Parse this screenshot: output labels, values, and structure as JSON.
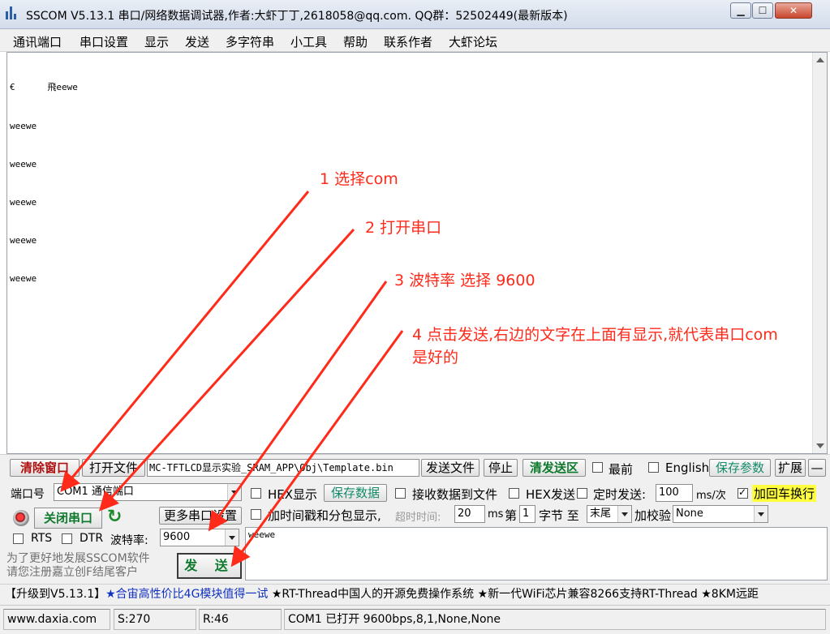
{
  "window": {
    "title": "SSCOM V5.13.1 串口/网络数据调试器,作者:大虾丁丁,2618058@qq.com. QQ群：52502449(最新版本)",
    "min": "▁",
    "max": "☐",
    "close": "✕"
  },
  "menu": [
    "通讯端口",
    "串口设置",
    "显示",
    "发送",
    "多字符串",
    "小工具",
    "帮助",
    "联系作者",
    "大虾论坛"
  ],
  "receive": {
    "lines": [
      "€      飛eewe",
      "weewe",
      "weewe",
      "weewe",
      "weewe",
      "weewe"
    ]
  },
  "toolbar": {
    "clear_window": "清除窗口",
    "open_file": "打开文件",
    "file_path": "MC-TFTLCD显示实验_SRAM_APP\\Obj\\Template.bin",
    "send_file": "发送文件",
    "stop": "停止",
    "clear_send": "清发送区",
    "top_most": "最前",
    "english": "English",
    "save_params": "保存参数",
    "expand": "扩展",
    "collapse": "—"
  },
  "port": {
    "label": "端口号",
    "value": "COM1 通信端口",
    "close_button": "关闭串口",
    "more_settings": "更多串口设置",
    "rts": "RTS",
    "dtr": "DTR",
    "baud_label": "波特率:",
    "baud_value": "9600"
  },
  "options": {
    "hex_display": "HEX显示",
    "save_data": "保存数据",
    "recv_to_file": "接收数据到文件",
    "hex_send": "HEX发送",
    "timed_send": "定时发送:",
    "interval_value": "100",
    "interval_unit": "ms/次",
    "add_crlf": "加回车换行",
    "timestamp": "加时间戳和分包显示,",
    "timeout_label": "超时时间:",
    "timeout_value": "20",
    "timeout_unit": "ms",
    "byte_prefix": "第",
    "byte_value": "1",
    "byte_suffix": "字节 至",
    "end_value": "末尾",
    "checksum_label": "加校验",
    "checksum_value": "None"
  },
  "send": {
    "text": "weewe",
    "button": "发  送",
    "notice": "为了更好地发展SSCOM软件\n请您注册嘉立创F结尾客户"
  },
  "ticker": {
    "items": [
      {
        "text": "【升级到V5.13.1】",
        "color": "black"
      },
      {
        "text": "★合宙高性价比4G模块值得一试",
        "color": "blue"
      },
      {
        "text": " ★RT-Thread中国人的开源免费操作系统 ★新一代WiFi芯片兼容8266支持RT-Thread ★8KM远距",
        "color": "black"
      }
    ]
  },
  "status": {
    "site": "www.daxia.com",
    "sent": "S:270",
    "received": "R:46",
    "port_state": "COM1 已打开  9600bps,8,1,None,None"
  },
  "annotations": {
    "step1": "1 选择com",
    "step2": "2 打开串口",
    "step3": "3 波特率 选择 9600",
    "step4_line1": "4 点击发送,右边的文字在上面有显示,就代表串口com",
    "step4_line2": "是好的"
  },
  "colors": {
    "annotation": "#ff2a1a",
    "ticker_highlight": "#1030c0",
    "button_green": "#0f7a2e",
    "button_red": "#b01010",
    "crlf_highlight": "#ffff40"
  }
}
